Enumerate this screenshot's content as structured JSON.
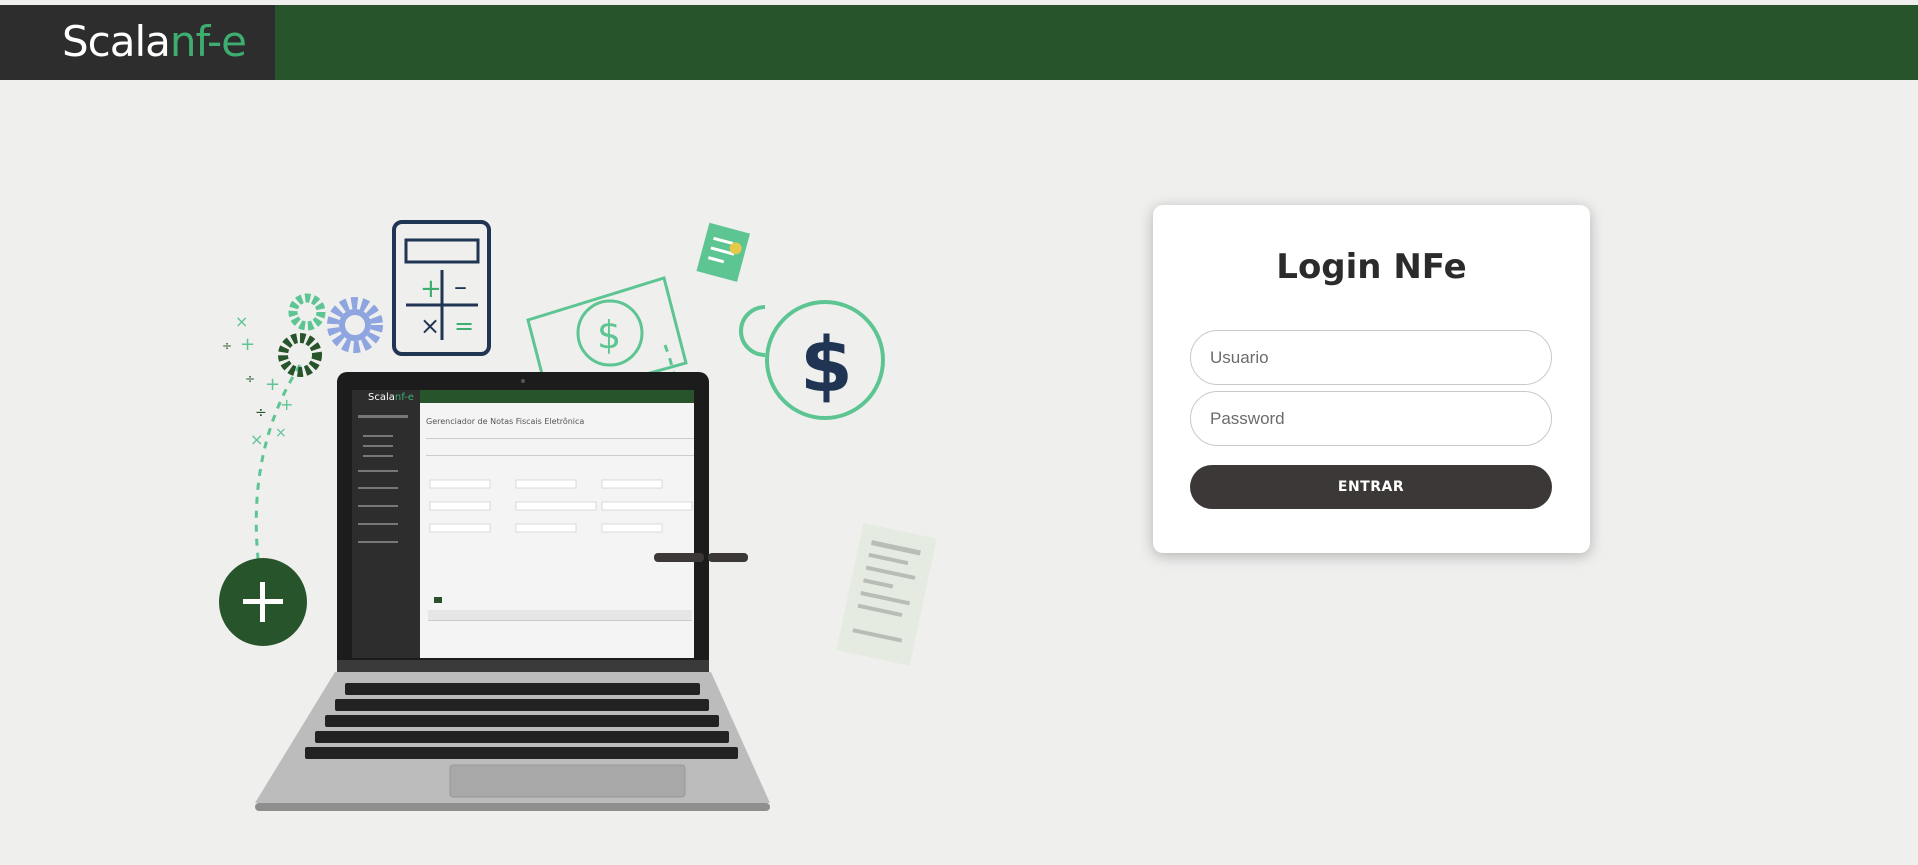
{
  "header": {
    "logo_part1": "Scala",
    "logo_part2": "nf-e",
    "bar_color": "#27542b",
    "logo_bg": "#2d2d2d"
  },
  "illustration": {
    "screen_logo_part1": "Scala",
    "screen_logo_part2": "nf-e",
    "screen_title": "Gerenciador de Notas Fiscais Eletrônica",
    "icons": [
      "calculator-icon",
      "gear-icon",
      "banknote-icon",
      "coin-dollar-icon",
      "receipt-icon",
      "plus-circle-icon",
      "laptop"
    ]
  },
  "login": {
    "title": "Login NFe",
    "username_placeholder": "Usuario",
    "password_placeholder": "Password",
    "submit_label": "ENTRAR"
  }
}
